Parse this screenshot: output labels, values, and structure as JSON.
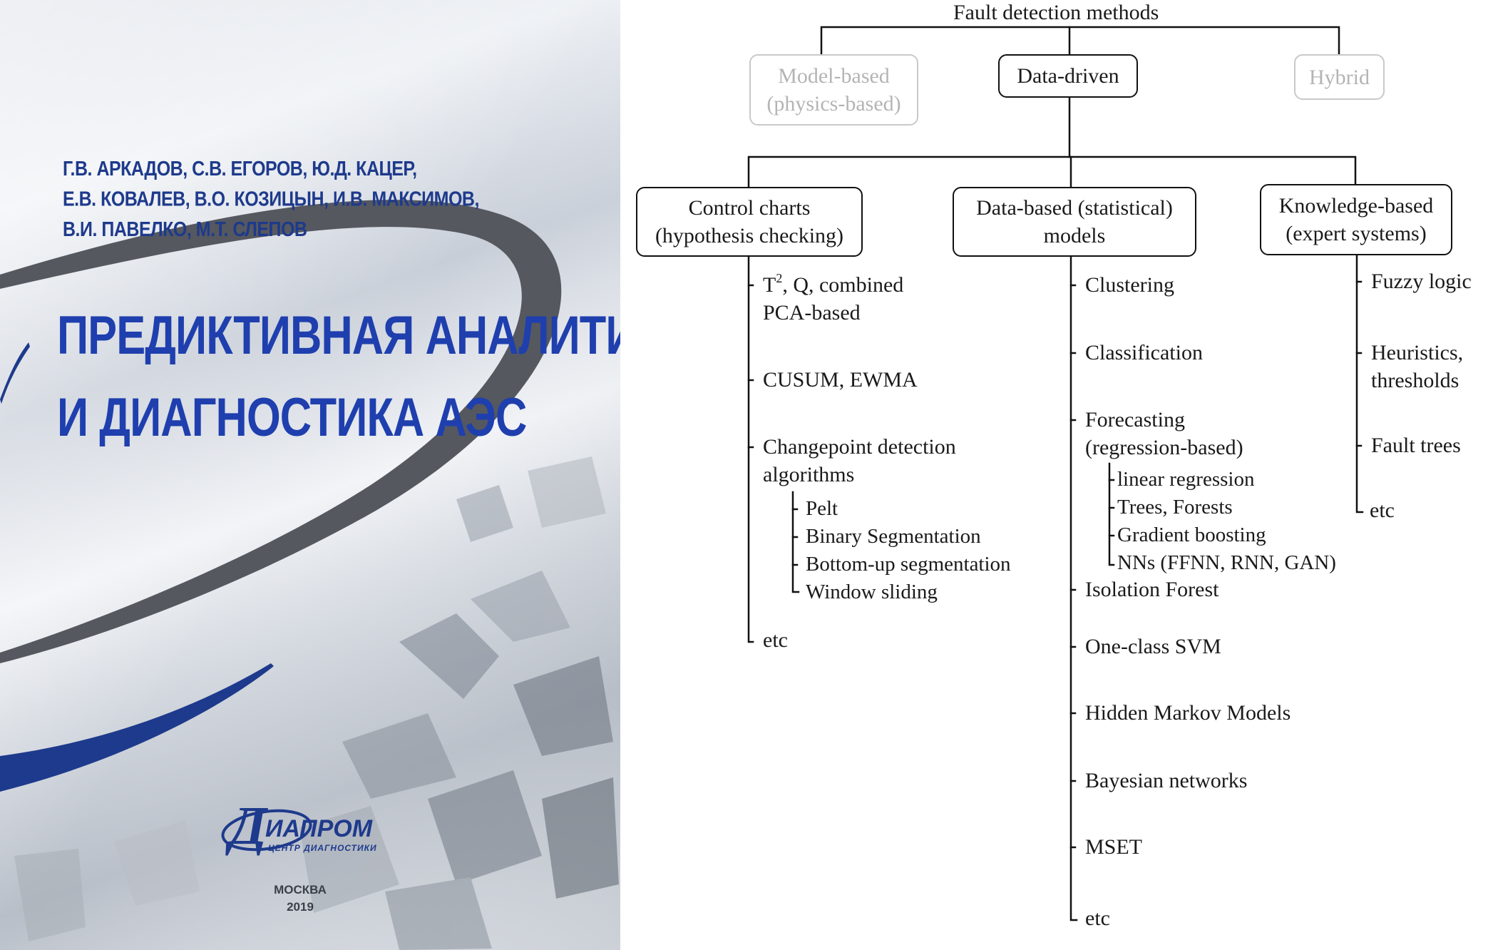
{
  "cover": {
    "authors": [
      "Г.В. АРКАДОВ, С.В. ЕГОРОВ, Ю.Д. КАЦЕР,",
      "Е.В. КОВАЛЕВ, В.О. КОЗИЦЫН, И.В. МАКСИМОВ,",
      "В.И. ПАВЕЛКО, М.Т. СЛЕПОВ"
    ],
    "title_lines": [
      "ПРЕДИКТИВНАЯ АНАЛИТИКА",
      "И ДИАГНОСТИКА АЭС"
    ],
    "publisher": {
      "letter": "Д",
      "name": "ИАПРОМ",
      "subtitle": "ЦЕНТР ДИАГНОСТИКИ"
    },
    "city": "МОСКВА",
    "year": "2019",
    "colors": {
      "title": "#1f3fae",
      "arc_dark": "#55585e",
      "arc_blue": "#1e3a8c"
    }
  },
  "diagram": {
    "root": "Fault detection methods",
    "top_level": {
      "model_based": [
        "Model-based",
        "(physics-based)"
      ],
      "data_driven": "Data-driven",
      "hybrid": "Hybrid"
    },
    "categories": {
      "control_charts": {
        "title": [
          "Control charts",
          "(hypothesis checking)"
        ],
        "items": {
          "t2_sup": "2",
          "t2_rest": ", Q, combined",
          "t2_prefix": "T",
          "pca": "PCA-based",
          "cusum": "CUSUM, EWMA",
          "changepoint": [
            "Changepoint detection",
            "algorithms"
          ],
          "changepoint_sub": [
            "Pelt",
            "Binary Segmentation",
            "Bottom-up segmentation",
            "Window sliding"
          ],
          "etc": "etc"
        }
      },
      "data_based": {
        "title": [
          "Data-based (statistical)",
          "models"
        ],
        "items": {
          "clustering": "Clustering",
          "classification": "Classification",
          "forecasting": [
            "Forecasting",
            "(regression-based)"
          ],
          "forecasting_sub": [
            "linear regression",
            "Trees, Forests",
            "Gradient boosting",
            "NNs (FFNN, RNN, GAN)"
          ],
          "isolation_forest": "Isolation Forest",
          "one_class_svm": "One-class SVM",
          "hmm": "Hidden Markov Models",
          "bayesian": "Bayesian networks",
          "mset": "MSET",
          "etc": "etc"
        }
      },
      "knowledge_based": {
        "title": [
          "Knowledge-based",
          "(expert systems)"
        ],
        "items": {
          "fuzzy": "Fuzzy logic",
          "heuristics": [
            "Heuristics,",
            "thresholds"
          ],
          "fault_trees": "Fault trees",
          "etc": "etc"
        }
      }
    },
    "colors": {
      "line": "#111111",
      "faded": "#c9c9c9",
      "faded_text": "#b4b4b4"
    }
  }
}
